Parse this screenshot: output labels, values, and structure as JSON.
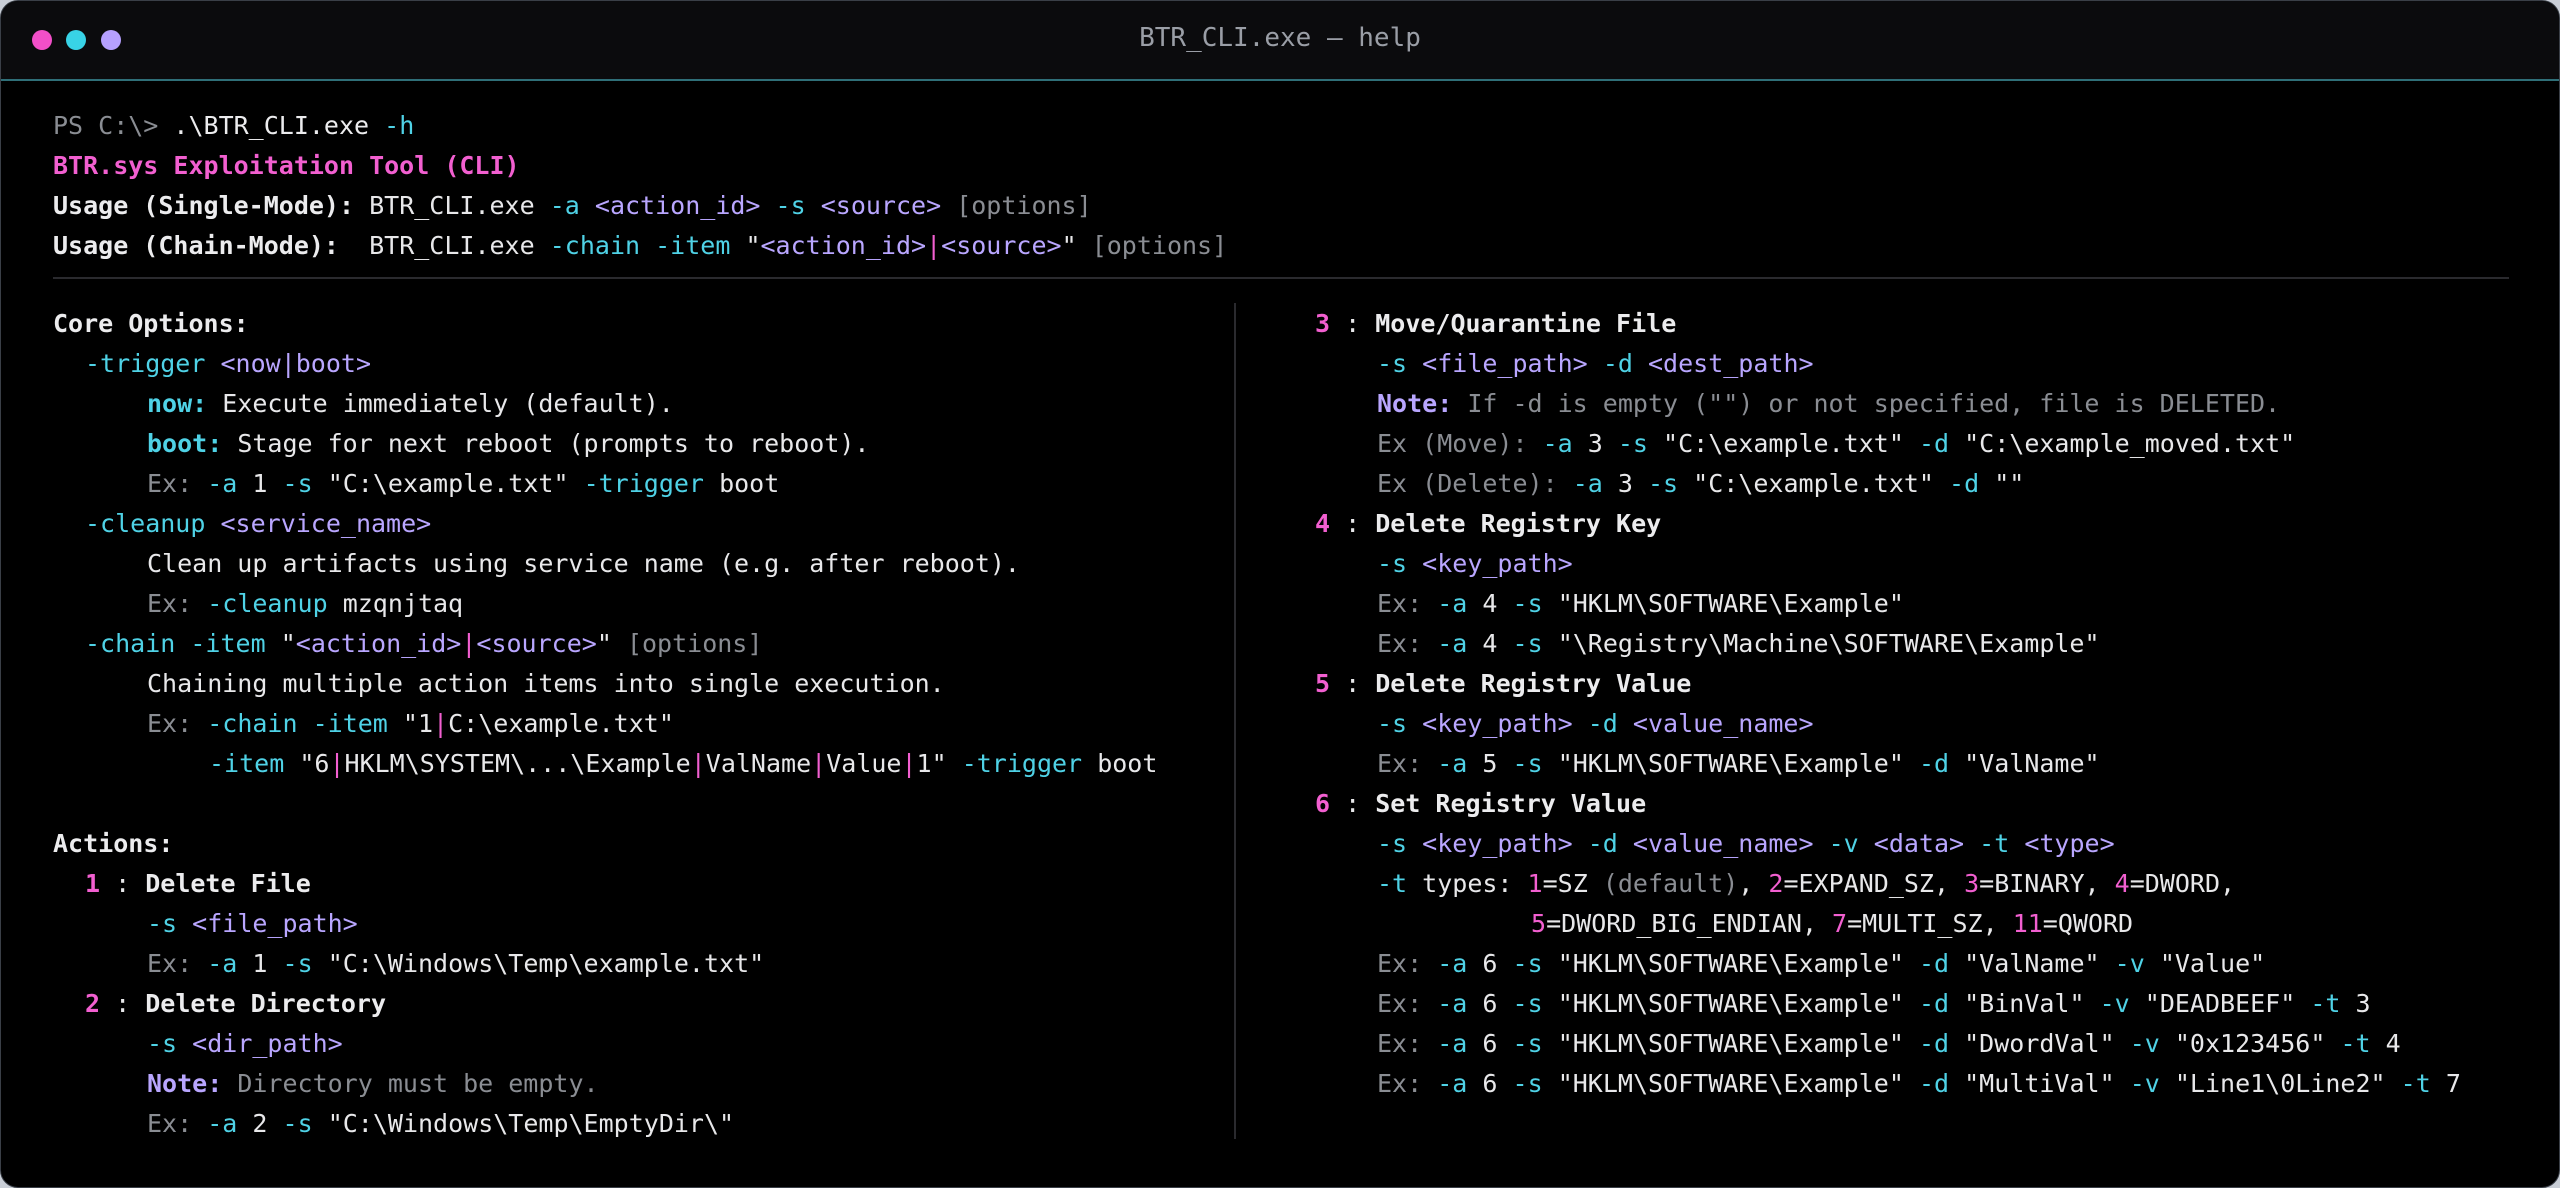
{
  "window": {
    "title": "BTR_CLI.exe — help"
  },
  "header": {
    "prompt": "PS C:\\>",
    "command": ".\\BTR_CLI.exe",
    "flag": "-h",
    "tool_title": "BTR.sys Exploitation Tool (CLI)",
    "single_label": "Usage (Single-Mode):",
    "single_exe": "BTR_CLI.exe",
    "chain_label": "Usage (Chain-Mode): ",
    "chain_exe": "BTR_CLI.exe",
    "a_flag": "-a",
    "action_id": "<action_id>",
    "s_flag": "-s",
    "source": "<source>",
    "options": "[options]",
    "chain_flag": "-chain",
    "item_flag": "-item",
    "q": "\"",
    "pipe": "|"
  },
  "core": {
    "heading": "Core Options:",
    "trigger_flag": "-trigger",
    "trigger_args": "<now|boot>",
    "now_label": "now:",
    "now_text": "Execute immediately (default).",
    "boot_label": "boot:",
    "boot_text": "Stage for next reboot (prompts to reboot).",
    "ex": "Ex:",
    "a": "-a",
    "s": "-s",
    "one": "1",
    "example_path": "\"C:\\example.txt\"",
    "boot_word": "boot",
    "cleanup_flag": "-cleanup",
    "cleanup_args": "<service_name>",
    "cleanup_text": "Clean up artifacts using service name (e.g. after reboot).",
    "cleanup_example": "mzqnjtaq",
    "chain_flag": "-chain",
    "item_flag": "-item",
    "action_id": "<action_id>",
    "source": "<source>",
    "q": "\"",
    "pipe": "|",
    "options": "[options]",
    "chain_text": "Chaining multiple action items into single execution.",
    "chain_ex1_a": "1",
    "chain_ex1_b": "C:\\example.txt",
    "chain_ex2_a": "6",
    "chain_ex2_b": "HKLM\\SYSTEM\\...\\Example",
    "chain_ex2_c": "ValName",
    "chain_ex2_d": "Value",
    "chain_ex2_e": "1"
  },
  "actions_heading": "Actions:",
  "actions": {
    "sep": " : ",
    "a1": {
      "id": "1",
      "name": "Delete File",
      "args": "<file_path>",
      "ex_path": "\"C:\\Windows\\Temp\\example.txt\""
    },
    "a2": {
      "id": "2",
      "name": "Delete Directory",
      "args": "<dir_path>",
      "note_label": "Note:",
      "note": "Directory must be empty.",
      "ex_path": "\"C:\\Windows\\Temp\\EmptyDir\\\""
    },
    "a3": {
      "id": "3",
      "name": "Move/Quarantine File",
      "args1": "<file_path>",
      "d_flag": "-d",
      "args2": "<dest_path>",
      "note_label": "Note:",
      "note": "If -d is empty (\"\") or not specified, file is DELETED.",
      "ex_move": "Ex (Move):",
      "ex_delete": "Ex (Delete):",
      "src": "\"C:\\example.txt\"",
      "dest": "\"C:\\example_moved.txt\"",
      "empty": "\"\""
    },
    "a4": {
      "id": "4",
      "name": "Delete Registry Key",
      "args": "<key_path>",
      "ex1": "\"HKLM\\SOFTWARE\\Example\"",
      "ex2": "\"\\Registry\\Machine\\SOFTWARE\\Example\""
    },
    "a5": {
      "id": "5",
      "name": "Delete Registry Value",
      "args1": "<key_path>",
      "args2": "<value_name>",
      "ex_key": "\"HKLM\\SOFTWARE\\Example\"",
      "ex_val": "\"ValName\""
    },
    "a6": {
      "id": "6",
      "name": "Set Registry Value",
      "args_key": "<key_path>",
      "args_val": "<value_name>",
      "v_flag": "-v",
      "args_data": "<data>",
      "t_flag": "-t",
      "args_type": "<type>",
      "types_label": "types:",
      "t1": "1",
      "t1n": "=SZ",
      "t1d": "(default)",
      "t2": "2",
      "t2n": "=EXPAND_SZ",
      "t3": "3",
      "t3n": "=BINARY",
      "t4": "4",
      "t4n": "=DWORD",
      "t5": "5",
      "t5n": "=DWORD_BIG_ENDIAN",
      "t7": "7",
      "t7n": "=MULTI_SZ",
      "t11": "11",
      "t11n": "=QWORD",
      "key": "\"HKLM\\SOFTWARE\\Example\"",
      "e1_name": "\"ValName\"",
      "e1_val": "\"Value\"",
      "e2_name": "\"BinVal\"",
      "e2_val": "\"DEADBEEF\"",
      "e2_t": "3",
      "e3_name": "\"DwordVal\"",
      "e3_val": "\"0x123456\"",
      "e3_t": "4",
      "e4_name": "\"MultiVal\"",
      "e4_val": "\"Line1\\0Line2\"",
      "e4_t": "7"
    }
  },
  "common": {
    "ex": "Ex:",
    "a": "-a",
    "s": "-s",
    "d": "-d",
    "comma": ", ",
    "comma_end": ","
  }
}
